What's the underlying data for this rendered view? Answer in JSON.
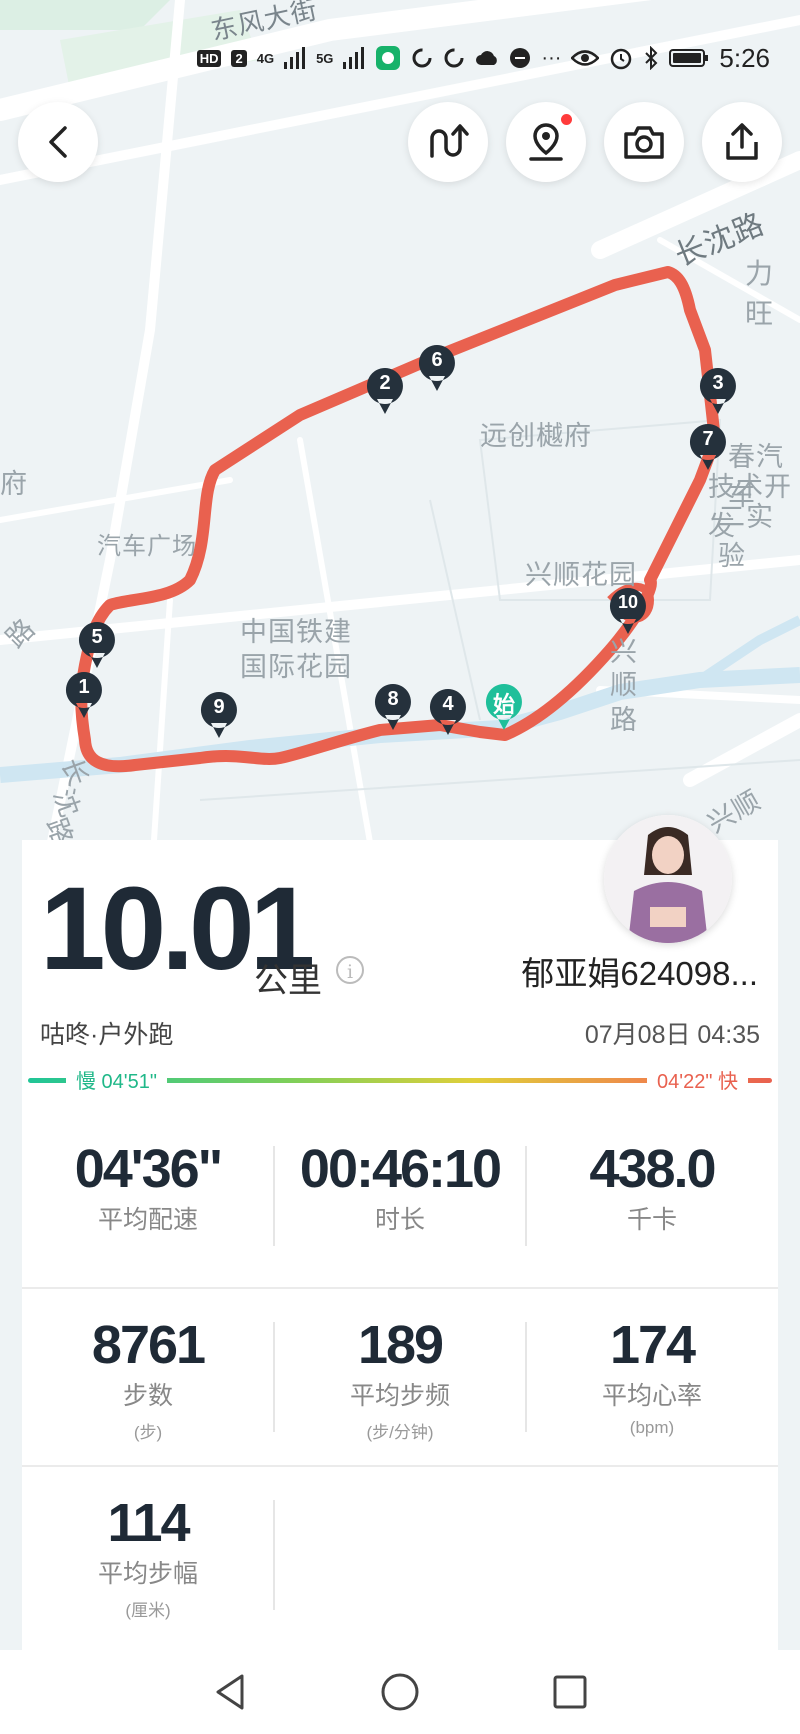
{
  "status_bar": {
    "hd": "HD",
    "sim": "2",
    "net1": "4G",
    "net2": "5G",
    "time": "5:26"
  },
  "map": {
    "labels": [
      "东风大街",
      "长沈路",
      "力旺",
      "远创樾府",
      "府",
      "汽车广场",
      "春汽车",
      "技术开发",
      "二实验",
      "兴顺花园",
      "中国铁建",
      "国际花园",
      "兴",
      "顺",
      "路",
      "路",
      "长",
      "沈",
      "路",
      "兴顺"
    ],
    "start_label": "始",
    "pins": [
      "1",
      "2",
      "3",
      "4",
      "5",
      "6",
      "7",
      "8",
      "9",
      "10"
    ],
    "route_color": "#e9614f"
  },
  "toolbar": {
    "back_icon": "back-icon",
    "buttons": [
      "route-replay-icon",
      "location-camera-icon",
      "camera-icon",
      "share-icon"
    ]
  },
  "summary": {
    "distance": "10.01",
    "distance_unit": "公里",
    "info_symbol": "i",
    "username": "郁亚娟624098...",
    "source": "咕咚·户外跑",
    "datetime": "07月08日 04:35",
    "pace_slow": "慢 04'51\"",
    "pace_fast": "04'22\" 快"
  },
  "stats": [
    {
      "value": "04'36\"",
      "label": "平均配速",
      "unit": ""
    },
    {
      "value": "00:46:10",
      "label": "时长",
      "unit": ""
    },
    {
      "value": "438.0",
      "label": "千卡",
      "unit": ""
    },
    {
      "value": "8761",
      "label": "步数",
      "unit": "(步)"
    },
    {
      "value": "189",
      "label": "平均步频",
      "unit": "(步/分钟)"
    },
    {
      "value": "174",
      "label": "平均心率",
      "unit": "(bpm)"
    },
    {
      "value": "114",
      "label": "平均步幅",
      "unit": "(厘米)"
    }
  ],
  "colors": {
    "accent": "#e9614f",
    "slow": "#20b889",
    "pin": "#25313c",
    "start_pin": "#1fbf9a"
  }
}
